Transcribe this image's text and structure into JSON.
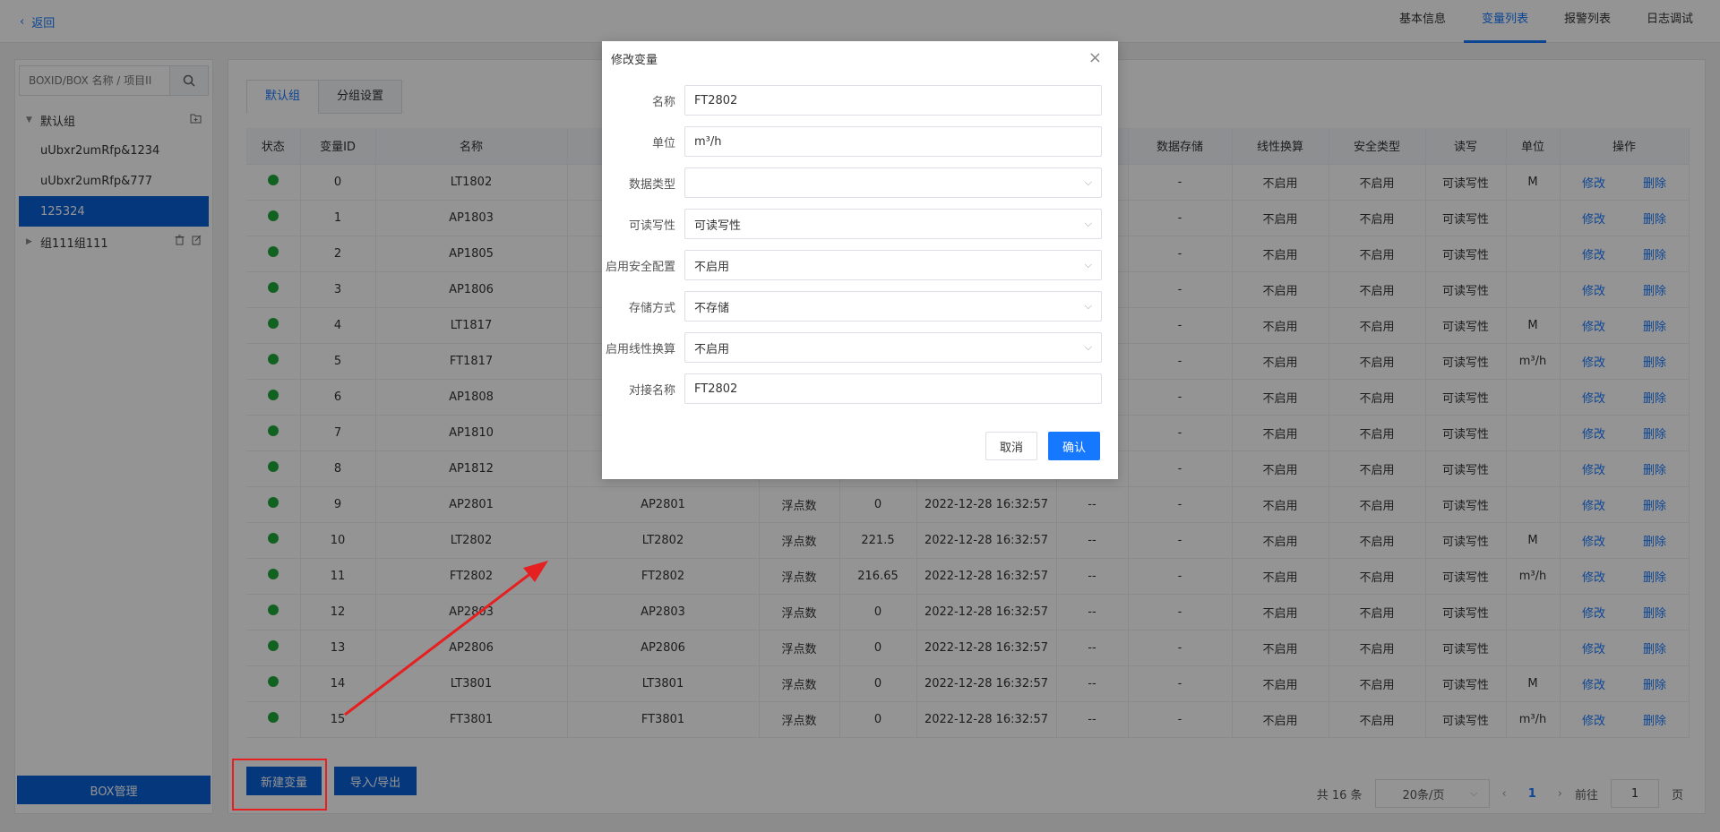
{
  "topbar": {
    "back_label": "返回",
    "tabs": [
      {
        "label": "基本信息"
      },
      {
        "label": "变量列表"
      },
      {
        "label": "报警列表"
      },
      {
        "label": "日志调试"
      }
    ],
    "active_tab": "变量列表"
  },
  "sidebar": {
    "search_placeholder": "BOXID/BOX 名称 / 项目II",
    "groups": [
      {
        "label": "默认组",
        "expanded": true
      },
      {
        "label": "组111组111",
        "expanded": false
      }
    ],
    "items": [
      {
        "label": "uUbxr2umRfp&1234"
      },
      {
        "label": "uUbxr2umRfp&777"
      },
      {
        "label": "125324",
        "selected": true
      }
    ],
    "box_manage_label": "BOX管理"
  },
  "main": {
    "group_tabs": [
      {
        "label": "默认组"
      },
      {
        "label": "分组设置"
      }
    ],
    "table": {
      "columns": [
        "状态",
        "变量ID",
        "名称",
        "",
        "",
        "",
        "",
        "",
        "数据存储",
        "线性换算",
        "安全类型",
        "读写",
        "单位",
        "操作"
      ],
      "rows": [
        {
          "id": "0",
          "name": "LT1802",
          "alias": "",
          "type": "",
          "value": "",
          "time": "",
          "x": "",
          "store": "-",
          "linear": "不启用",
          "safe": "不启用",
          "rw": "可读写性",
          "unit": "M"
        },
        {
          "id": "1",
          "name": "AP1803",
          "alias": "",
          "type": "",
          "value": "",
          "time": "",
          "x": "",
          "store": "-",
          "linear": "不启用",
          "safe": "不启用",
          "rw": "可读写性",
          "unit": ""
        },
        {
          "id": "2",
          "name": "AP1805",
          "alias": "",
          "type": "",
          "value": "",
          "time": "",
          "x": "",
          "store": "-",
          "linear": "不启用",
          "safe": "不启用",
          "rw": "可读写性",
          "unit": ""
        },
        {
          "id": "3",
          "name": "AP1806",
          "alias": "",
          "type": "",
          "value": "",
          "time": "",
          "x": "",
          "store": "-",
          "linear": "不启用",
          "safe": "不启用",
          "rw": "可读写性",
          "unit": ""
        },
        {
          "id": "4",
          "name": "LT1817",
          "alias": "",
          "type": "",
          "value": "",
          "time": "",
          "x": "",
          "store": "-",
          "linear": "不启用",
          "safe": "不启用",
          "rw": "可读写性",
          "unit": "M"
        },
        {
          "id": "5",
          "name": "FT1817",
          "alias": "",
          "type": "",
          "value": "",
          "time": "",
          "x": "",
          "store": "-",
          "linear": "不启用",
          "safe": "不启用",
          "rw": "可读写性",
          "unit": "m³/h"
        },
        {
          "id": "6",
          "name": "AP1808",
          "alias": "",
          "type": "",
          "value": "",
          "time": "",
          "x": "",
          "store": "-",
          "linear": "不启用",
          "safe": "不启用",
          "rw": "可读写性",
          "unit": ""
        },
        {
          "id": "7",
          "name": "AP1810",
          "alias": "",
          "type": "",
          "value": "",
          "time": "",
          "x": "",
          "store": "-",
          "linear": "不启用",
          "safe": "不启用",
          "rw": "可读写性",
          "unit": ""
        },
        {
          "id": "8",
          "name": "AP1812",
          "alias": "",
          "type": "",
          "value": "",
          "time": "",
          "x": "",
          "store": "-",
          "linear": "不启用",
          "safe": "不启用",
          "rw": "可读写性",
          "unit": ""
        },
        {
          "id": "9",
          "name": "AP2801",
          "alias": "AP2801",
          "type": "浮点数",
          "value": "0",
          "time": "2022-12-28 16:32:57",
          "x": "--",
          "store": "-",
          "linear": "不启用",
          "safe": "不启用",
          "rw": "可读写性",
          "unit": ""
        },
        {
          "id": "10",
          "name": "LT2802",
          "alias": "LT2802",
          "type": "浮点数",
          "value": "221.5",
          "time": "2022-12-28 16:32:57",
          "x": "--",
          "store": "-",
          "linear": "不启用",
          "safe": "不启用",
          "rw": "可读写性",
          "unit": "M"
        },
        {
          "id": "11",
          "name": "FT2802",
          "alias": "FT2802",
          "type": "浮点数",
          "value": "216.65",
          "time": "2022-12-28 16:32:57",
          "x": "--",
          "store": "-",
          "linear": "不启用",
          "safe": "不启用",
          "rw": "可读写性",
          "unit": "m³/h"
        },
        {
          "id": "12",
          "name": "AP2803",
          "alias": "AP2803",
          "type": "浮点数",
          "value": "0",
          "time": "2022-12-28 16:32:57",
          "x": "--",
          "store": "-",
          "linear": "不启用",
          "safe": "不启用",
          "rw": "可读写性",
          "unit": ""
        },
        {
          "id": "13",
          "name": "AP2806",
          "alias": "AP2806",
          "type": "浮点数",
          "value": "0",
          "time": "2022-12-28 16:32:57",
          "x": "--",
          "store": "-",
          "linear": "不启用",
          "safe": "不启用",
          "rw": "可读写性",
          "unit": ""
        },
        {
          "id": "14",
          "name": "LT3801",
          "alias": "LT3801",
          "type": "浮点数",
          "value": "0",
          "time": "2022-12-28 16:32:57",
          "x": "--",
          "store": "-",
          "linear": "不启用",
          "safe": "不启用",
          "rw": "可读写性",
          "unit": "M"
        },
        {
          "id": "15",
          "name": "FT3801",
          "alias": "FT3801",
          "type": "浮点数",
          "value": "0",
          "time": "2022-12-28 16:32:57",
          "x": "--",
          "store": "-",
          "linear": "不启用",
          "safe": "不启用",
          "rw": "可读写性",
          "unit": "m³/h"
        }
      ],
      "edit_label": "修改",
      "delete_label": "删除"
    },
    "new_var_label": "新建变量",
    "import_export_label": "导入/导出",
    "pager": {
      "total": "共 16 条",
      "page_size": "20条/页",
      "current": "1",
      "goto_label": "前往",
      "goto_value": "1",
      "page_unit": "页"
    }
  },
  "dialog": {
    "title": "修改变量",
    "fields": [
      {
        "label": "名称",
        "value": "FT2802",
        "kind": "input"
      },
      {
        "label": "单位",
        "value": "m³/h",
        "kind": "input"
      },
      {
        "label": "数据类型",
        "value": "",
        "kind": "select"
      },
      {
        "label": "可读写性",
        "value": "可读写性",
        "kind": "select"
      },
      {
        "label": "启用安全配置",
        "value": "不启用",
        "kind": "select"
      },
      {
        "label": "存储方式",
        "value": "不存储",
        "kind": "select"
      },
      {
        "label": "启用线性换算",
        "value": "不启用",
        "kind": "select"
      },
      {
        "label": "对接名称",
        "value": "FT2802",
        "kind": "input"
      }
    ],
    "cancel_label": "取消",
    "ok_label": "确认"
  },
  "colors": {
    "primary": "#1677ff",
    "button_dark": "#0a5fd6",
    "status_ok": "#22a83a",
    "annotation": "#e62020"
  }
}
